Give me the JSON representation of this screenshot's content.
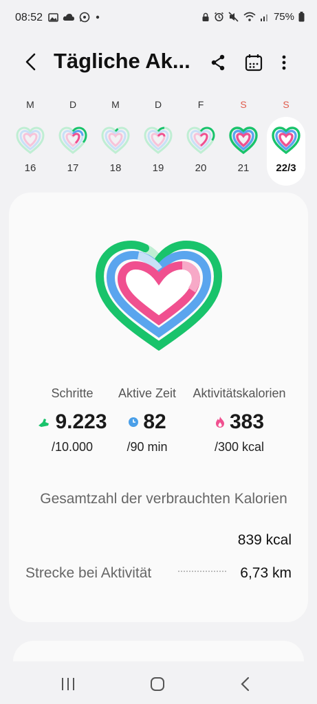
{
  "status_bar": {
    "time": "08:52",
    "battery": "75%",
    "left_icons": [
      "image-icon",
      "cloud-icon",
      "whatsapp-icon",
      "dot-icon"
    ],
    "right_icons": [
      "lock-icon",
      "alarm-icon",
      "mute-icon",
      "wifi-icon",
      "signal-icon",
      "battery-icon"
    ]
  },
  "header": {
    "title": "Tägliche Ak...",
    "icons": [
      "back-icon",
      "share-icon",
      "calendar-icon",
      "more-icon"
    ]
  },
  "week": {
    "days": [
      {
        "letter": "M",
        "date": "16",
        "selected": false
      },
      {
        "letter": "D",
        "date": "17",
        "selected": false
      },
      {
        "letter": "M",
        "date": "18",
        "selected": false
      },
      {
        "letter": "D",
        "date": "19",
        "selected": false
      },
      {
        "letter": "F",
        "date": "20",
        "selected": false
      },
      {
        "letter": "S",
        "date": "21",
        "selected": false
      },
      {
        "letter": "S",
        "date": "22/3",
        "selected": true
      }
    ],
    "sunday_color": "#e05a4a"
  },
  "summary": {
    "steps": {
      "label": "Schritte",
      "value": "9.223",
      "goal": "/10.000",
      "icon": "shoe-icon",
      "color": "#19c36b"
    },
    "active_time": {
      "label": "Aktive Zeit",
      "value": "82",
      "goal": "/90 min",
      "icon": "clock-icon",
      "color": "#4a9fe8"
    },
    "calories": {
      "label": "Aktivitätskalorien",
      "value": "383",
      "goal": "/300 kcal",
      "icon": "flame-icon",
      "color": "#f0508f"
    },
    "total_label": "Gesamtzahl der verbrauchten Kalorien",
    "total_value": "839 kcal",
    "distance_label": "Strecke bei Aktivität",
    "distance_value": "6,73 km"
  },
  "colors": {
    "green": "#19c36b",
    "blue": "#5aa5ee",
    "pink": "#f0508f"
  },
  "nav": [
    "recents-icon",
    "home-icon",
    "back-nav-icon"
  ]
}
